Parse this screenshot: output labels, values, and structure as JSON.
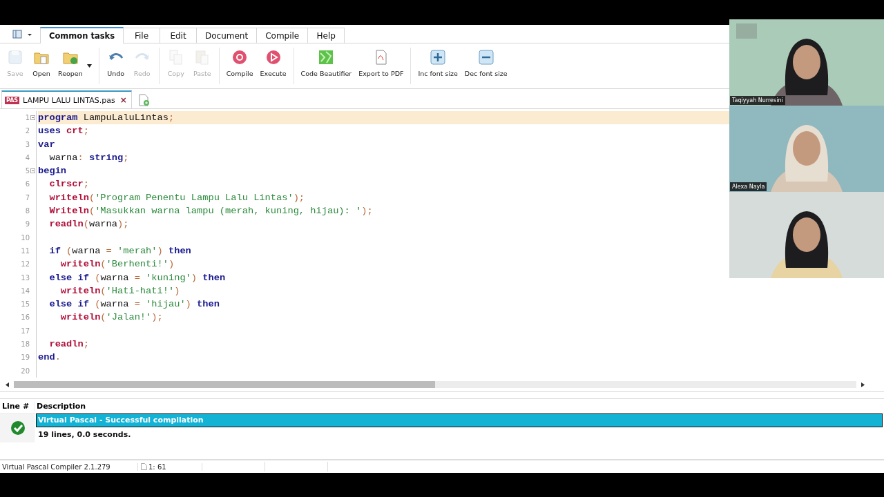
{
  "ribbon_tabs": [
    {
      "label": "Common tasks",
      "selected": true
    },
    {
      "label": "File",
      "selected": false
    },
    {
      "label": "Edit",
      "selected": false
    },
    {
      "label": "Document",
      "selected": false
    },
    {
      "label": "Compile",
      "selected": false
    },
    {
      "label": "Help",
      "selected": false
    }
  ],
  "toolbar_groups": [
    [
      {
        "kind": "save",
        "label": "Save",
        "disabled": true
      },
      {
        "kind": "open",
        "label": "Open",
        "disabled": false
      },
      {
        "kind": "reopen",
        "label": "Reopen",
        "disabled": false
      }
    ],
    [
      {
        "kind": "undo",
        "label": "Undo",
        "disabled": false
      },
      {
        "kind": "redo",
        "label": "Redo",
        "disabled": true
      }
    ],
    [
      {
        "kind": "copy",
        "label": "Copy",
        "disabled": true
      },
      {
        "kind": "paste",
        "label": "Paste",
        "disabled": true
      }
    ],
    [
      {
        "kind": "compile",
        "label": "Compile",
        "disabled": false
      },
      {
        "kind": "execute",
        "label": "Execute",
        "disabled": false
      }
    ],
    [
      {
        "kind": "beautify",
        "label": "Code Beautifier",
        "disabled": false
      },
      {
        "kind": "pdf",
        "label": "Export to PDF",
        "disabled": false
      }
    ],
    [
      {
        "kind": "plus",
        "label": "Inc font size",
        "disabled": false
      },
      {
        "kind": "minus",
        "label": "Dec font size",
        "disabled": false
      }
    ]
  ],
  "document_tab": {
    "badge": "PAS",
    "title": "LAMPU LALU LINTAS.pas",
    "close": "×"
  },
  "code_lines": [
    {
      "number": "1",
      "fold": true,
      "current": true,
      "tokens": [
        {
          "kind": "keyword",
          "t": "program"
        },
        {
          "kind": "ident",
          "t": " LampuLaluLintas"
        },
        {
          "kind": "punct",
          "t": ";"
        }
      ]
    },
    {
      "number": "2",
      "fold": false,
      "current": false,
      "tokens": [
        {
          "kind": "keyword",
          "t": "uses "
        },
        {
          "kind": "function",
          "t": "crt"
        },
        {
          "kind": "punct",
          "t": ";"
        }
      ]
    },
    {
      "number": "3",
      "fold": false,
      "current": false,
      "tokens": [
        {
          "kind": "keyword",
          "t": "var"
        }
      ]
    },
    {
      "number": "4",
      "fold": false,
      "current": false,
      "tokens": [
        {
          "kind": "ident",
          "t": "  warna"
        },
        {
          "kind": "punct",
          "t": ": "
        },
        {
          "kind": "keyword",
          "t": "string"
        },
        {
          "kind": "punct",
          "t": ";"
        }
      ]
    },
    {
      "number": "5",
      "fold": true,
      "current": false,
      "tokens": [
        {
          "kind": "keyword",
          "t": "begin"
        }
      ]
    },
    {
      "number": "6",
      "fold": false,
      "current": false,
      "tokens": [
        {
          "kind": "function",
          "t": "  clrscr"
        },
        {
          "kind": "punct",
          "t": ";"
        }
      ]
    },
    {
      "number": "7",
      "fold": false,
      "current": false,
      "tokens": [
        {
          "kind": "function",
          "t": "  writeln"
        },
        {
          "kind": "punct",
          "t": "("
        },
        {
          "kind": "string",
          "t": "'Program Penentu Lampu Lalu Lintas'"
        },
        {
          "kind": "punct",
          "t": ");"
        }
      ]
    },
    {
      "number": "8",
      "fold": false,
      "current": false,
      "tokens": [
        {
          "kind": "function",
          "t": "  Writeln"
        },
        {
          "kind": "punct",
          "t": "("
        },
        {
          "kind": "string",
          "t": "'Masukkan warna lampu (merah, kuning, hijau): '"
        },
        {
          "kind": "punct",
          "t": ");"
        }
      ]
    },
    {
      "number": "9",
      "fold": false,
      "current": false,
      "tokens": [
        {
          "kind": "function",
          "t": "  readln"
        },
        {
          "kind": "punct",
          "t": "("
        },
        {
          "kind": "ident",
          "t": "warna"
        },
        {
          "kind": "punct",
          "t": ");"
        }
      ]
    },
    {
      "number": "10",
      "fold": false,
      "current": false
    },
    {
      "number": "11",
      "fold": false,
      "current": false,
      "tokens": [
        {
          "kind": "keyword",
          "t": "  if"
        },
        {
          "kind": "punct",
          "t": " ("
        },
        {
          "kind": "ident",
          "t": "warna"
        },
        {
          "kind": "punct",
          "t": " = "
        },
        {
          "kind": "string",
          "t": "'merah'"
        },
        {
          "kind": "punct",
          "t": ") "
        },
        {
          "kind": "keyword",
          "t": "then"
        }
      ]
    },
    {
      "number": "12",
      "fold": false,
      "current": false,
      "tokens": [
        {
          "kind": "function",
          "t": "    writeln"
        },
        {
          "kind": "punct",
          "t": "("
        },
        {
          "kind": "string",
          "t": "'Berhenti!'"
        },
        {
          "kind": "punct",
          "t": ")"
        }
      ]
    },
    {
      "number": "13",
      "fold": false,
      "current": false,
      "tokens": [
        {
          "kind": "keyword",
          "t": "  else if"
        },
        {
          "kind": "punct",
          "t": " ("
        },
        {
          "kind": "ident",
          "t": "warna"
        },
        {
          "kind": "punct",
          "t": " = "
        },
        {
          "kind": "string",
          "t": "'kuning'"
        },
        {
          "kind": "punct",
          "t": ") "
        },
        {
          "kind": "keyword",
          "t": "then"
        }
      ]
    },
    {
      "number": "14",
      "fold": false,
      "current": false,
      "tokens": [
        {
          "kind": "function",
          "t": "    writeln"
        },
        {
          "kind": "punct",
          "t": "("
        },
        {
          "kind": "string",
          "t": "'Hati-hati!'"
        },
        {
          "kind": "punct",
          "t": ")"
        }
      ]
    },
    {
      "number": "15",
      "fold": false,
      "current": false,
      "tokens": [
        {
          "kind": "keyword",
          "t": "  else if"
        },
        {
          "kind": "punct",
          "t": " ("
        },
        {
          "kind": "ident",
          "t": "warna"
        },
        {
          "kind": "punct",
          "t": " = "
        },
        {
          "kind": "string",
          "t": "'hijau'"
        },
        {
          "kind": "punct",
          "t": ") "
        },
        {
          "kind": "keyword",
          "t": "then"
        }
      ]
    },
    {
      "number": "16",
      "fold": false,
      "current": false,
      "tokens": [
        {
          "kind": "function",
          "t": "    writeln"
        },
        {
          "kind": "punct",
          "t": "("
        },
        {
          "kind": "string",
          "t": "'Jalan!'"
        },
        {
          "kind": "punct",
          "t": ");"
        }
      ]
    },
    {
      "number": "17",
      "fold": false,
      "current": false
    },
    {
      "number": "18",
      "fold": false,
      "current": false,
      "tokens": [
        {
          "kind": "function",
          "t": "  readln"
        },
        {
          "kind": "punct",
          "t": ";"
        }
      ]
    },
    {
      "number": "19",
      "fold": false,
      "current": false,
      "tokens": [
        {
          "kind": "keyword",
          "t": "end"
        },
        {
          "kind": "punct",
          "t": "."
        }
      ]
    },
    {
      "number": "20",
      "fold": false,
      "current": false
    }
  ],
  "messages": {
    "columns": [
      "Line #",
      "Description"
    ],
    "rows": [
      {
        "kind": "success",
        "title": "Virtual Pascal - Successful compilation",
        "selected": true,
        "detail": "19 lines, 0.0 seconds."
      }
    ]
  },
  "status_bar": {
    "compiler": "Virtual Pascal Compiler 2.1.279",
    "position": "1: 61"
  },
  "participants": [
    {
      "name": "Taqiyyah Nurresini",
      "kind": "picture"
    },
    {
      "name": "Alexa Nayla",
      "kind": "picture"
    },
    {
      "kind": "picture"
    }
  ]
}
